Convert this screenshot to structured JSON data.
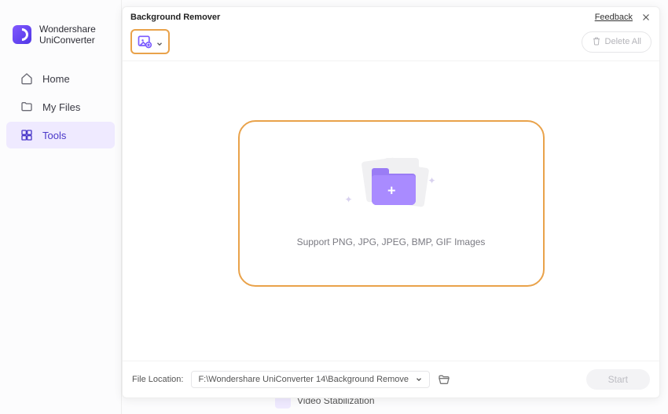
{
  "brand": {
    "line1": "Wondershare",
    "line2": "UniConverter"
  },
  "sidebar": {
    "items": [
      {
        "label": "Home"
      },
      {
        "label": "My Files"
      },
      {
        "label": "Tools"
      }
    ]
  },
  "tool_below": {
    "label": "Video Stabilization"
  },
  "modal": {
    "title": "Background Remover",
    "feedback": "Feedback",
    "delete_all": "Delete All",
    "support_text": "Support PNG, JPG, JPEG, BMP, GIF Images",
    "footer": {
      "label": "File Location:",
      "path": "F:\\Wondershare UniConverter 14\\Background Remove",
      "start": "Start"
    }
  }
}
